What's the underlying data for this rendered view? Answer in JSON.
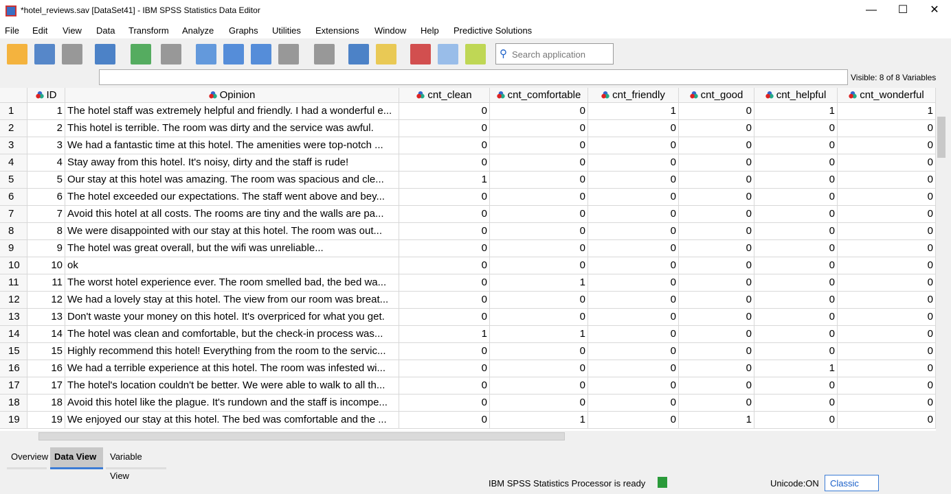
{
  "window": {
    "title": "*hotel_reviews.sav [DataSet41] - IBM SPSS Statistics Data Editor",
    "minimize": "—",
    "maximize": "☐",
    "close": "✕"
  },
  "menu": [
    "File",
    "Edit",
    "View",
    "Data",
    "Transform",
    "Analyze",
    "Graphs",
    "Utilities",
    "Extensions",
    "Window",
    "Help",
    "Predictive Solutions"
  ],
  "toolbar": {
    "icons": [
      "open-folder",
      "save",
      "print",
      "recall-dialog",
      "undo",
      "redo",
      "go-to-case",
      "go-to-variable",
      "variables",
      "insert-variable",
      "find",
      "split-file",
      "select-cases",
      "value-labels",
      "use-sets",
      "add-extension"
    ],
    "search_placeholder": "Search application"
  },
  "visible_label": "Visible: 8 of 8 Variables",
  "columns": [
    "ID",
    "Opinion",
    "cnt_clean",
    "cnt_comfortable",
    "cnt_friendly",
    "cnt_good",
    "cnt_helpful",
    "cnt_wonderful"
  ],
  "rows": [
    [
      "1",
      "The hotel staff was extremely helpful and friendly. I had a wonderful e...",
      "0",
      "0",
      "1",
      "0",
      "1",
      "1"
    ],
    [
      "2",
      "This hotel is terrible. The room was dirty and the service was awful.",
      "0",
      "0",
      "0",
      "0",
      "0",
      "0"
    ],
    [
      "3",
      "We had a fantastic time at this hotel. The amenities were top-notch ...",
      "0",
      "0",
      "0",
      "0",
      "0",
      "0"
    ],
    [
      "4",
      "Stay away from this hotel. It's noisy, dirty and the staff is rude!",
      "0",
      "0",
      "0",
      "0",
      "0",
      "0"
    ],
    [
      "5",
      "Our stay at this hotel was amazing. The room was spacious and cle...",
      "1",
      "0",
      "0",
      "0",
      "0",
      "0"
    ],
    [
      "6",
      "The hotel exceeded our expectations. The staff went above and bey...",
      "0",
      "0",
      "0",
      "0",
      "0",
      "0"
    ],
    [
      "7",
      "Avoid this hotel at all costs. The rooms are tiny and the walls are pa...",
      "0",
      "0",
      "0",
      "0",
      "0",
      "0"
    ],
    [
      "8",
      "We were disappointed with our stay at this hotel. The room was out...",
      "0",
      "0",
      "0",
      "0",
      "0",
      "0"
    ],
    [
      "9",
      "The hotel was great overall, but the wifi was unreliable...",
      "0",
      "0",
      "0",
      "0",
      "0",
      "0"
    ],
    [
      "10",
      "ok",
      "0",
      "0",
      "0",
      "0",
      "0",
      "0"
    ],
    [
      "11",
      "The worst hotel experience ever. The room smelled bad, the bed wa...",
      "0",
      "1",
      "0",
      "0",
      "0",
      "0"
    ],
    [
      "12",
      "We had a lovely stay at this hotel. The view from our room was breat...",
      "0",
      "0",
      "0",
      "0",
      "0",
      "0"
    ],
    [
      "13",
      "Don't waste your money on this hotel. It's overpriced for what you get.",
      "0",
      "0",
      "0",
      "0",
      "0",
      "0"
    ],
    [
      "14",
      "The hotel was clean and comfortable,  but the check-in process was...",
      "1",
      "1",
      "0",
      "0",
      "0",
      "0"
    ],
    [
      "15",
      "Highly recommend this hotel! Everything from the room to the servic...",
      "0",
      "0",
      "0",
      "0",
      "0",
      "0"
    ],
    [
      "16",
      "We had a terrible experience at this hotel. The room was infested wi...",
      "0",
      "0",
      "0",
      "0",
      "1",
      "0"
    ],
    [
      "17",
      "The hotel's location couldn't be better. We were able to walk to all th...",
      "0",
      "0",
      "0",
      "0",
      "0",
      "0"
    ],
    [
      "18",
      "Avoid this hotel like the plague. It's rundown and the staff is incompe...",
      "0",
      "0",
      "0",
      "0",
      "0",
      "0"
    ],
    [
      "19",
      "We enjoyed our stay at this hotel. The bed was comfortable and the ...",
      "0",
      "1",
      "0",
      "1",
      "0",
      "0"
    ]
  ],
  "tabs": [
    "Overview",
    "Data View",
    "Variable View"
  ],
  "active_tab": "Data View",
  "status": {
    "processor": "IBM SPSS Statistics Processor is ready",
    "unicode": "Unicode:ON",
    "mode": "Classic"
  }
}
